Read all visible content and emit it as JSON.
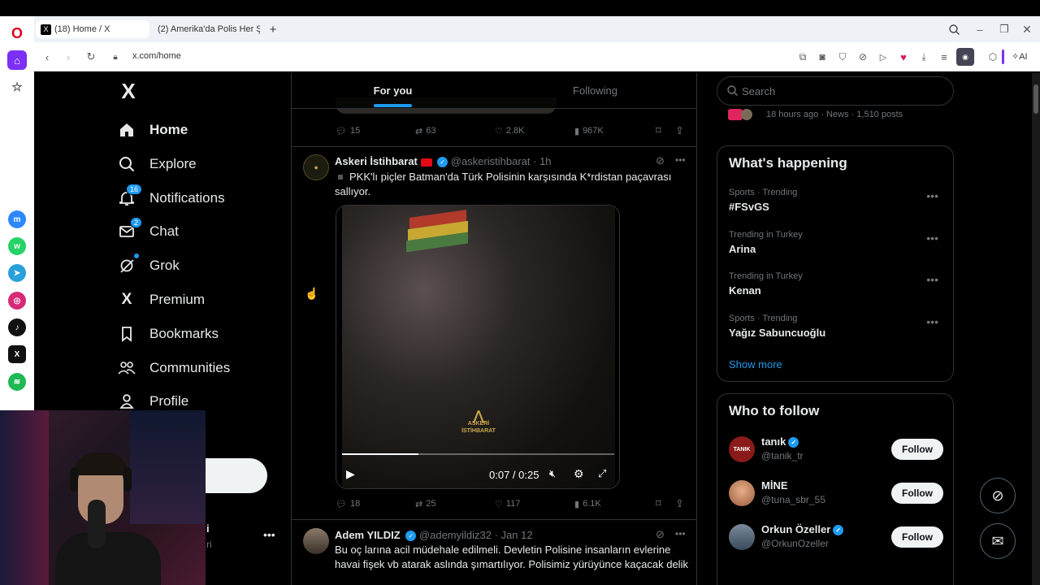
{
  "browser": {
    "tabs": [
      {
        "title": "(18) Home / X",
        "active": true
      },
      {
        "title": "(2) Amerika'da Polis Her Ş...",
        "active": false
      }
    ],
    "url": "x.com/home",
    "ai_label": "AI"
  },
  "sidebar": {
    "logo": "X",
    "items": [
      {
        "label": "Home",
        "icon": "home-icon",
        "badge": ""
      },
      {
        "label": "Explore",
        "icon": "search-icon",
        "badge": ""
      },
      {
        "label": "Notifications",
        "icon": "bell-icon",
        "badge": "16"
      },
      {
        "label": "Chat",
        "icon": "mail-icon",
        "badge": "2"
      },
      {
        "label": "Grok",
        "icon": "grok-icon",
        "badge": ""
      },
      {
        "label": "Premium",
        "icon": "x-icon",
        "badge": ""
      },
      {
        "label": "Bookmarks",
        "icon": "bookmark-icon",
        "badge": ""
      },
      {
        "label": "Communities",
        "icon": "people-icon",
        "badge": ""
      },
      {
        "label": "Profile",
        "icon": "person-icon",
        "badge": ""
      }
    ],
    "account_fragment_1": "i",
    "account_fragment_2": "ri"
  },
  "feed": {
    "tabs": [
      "For you",
      "Following"
    ],
    "prev_actions": {
      "replies": "15",
      "reposts": "63",
      "likes": "2.8K",
      "views": "967K"
    },
    "tweet1": {
      "name": "Askeri İstihbarat",
      "handle": "@askeristihbarat",
      "time": "1h",
      "text": "PKK'lı piçler  Batman'da Türk Polisinin karşısında K*rdistan paçavrası sallıyor.",
      "video_time": "0:07 / 0:25",
      "watermark_line1": "ASKERİ",
      "watermark_line2": "İSTİHBARAT",
      "progress": 0.28,
      "actions": {
        "replies": "18",
        "reposts": "25",
        "likes": "117",
        "views": "6.1K"
      }
    },
    "tweet2": {
      "name": "Adem YILDIZ",
      "handle": "@ademyildiz32",
      "time": "Jan 12",
      "text": "Bu oç larına acil müdehale edilmeli. Devletin Polisine insanların evlerine havai fişek vb atarak aslında şımartılıyor. Polisimiz yürüyünce kaçacak delik"
    }
  },
  "right": {
    "search_placeholder": "Search",
    "news_meta": "18 hours ago · News · 1,510 posts",
    "whats_happening": "What's happening",
    "trends": [
      {
        "category": "Sports · Trending",
        "title": "#FSvGS"
      },
      {
        "category": "Trending in Turkey",
        "title": "Arina"
      },
      {
        "category": "Trending in Turkey",
        "title": "Kenan"
      },
      {
        "category": "Sports · Trending",
        "title": "Yağız Sabuncuoğlu"
      }
    ],
    "show_more": "Show more",
    "who_to_follow": "Who to follow",
    "follow_label": "Follow",
    "suggestions": [
      {
        "name": "tanık",
        "handle": "@tanik_tr",
        "verified": true,
        "avatar_text": "TANIK",
        "color": "#8b1a1a"
      },
      {
        "name": "MİNE",
        "handle": "@tuna_sbr_55",
        "verified": false,
        "avatar_text": "",
        "color": "#c98a5a"
      },
      {
        "name": "Orkun Özeller",
        "handle": "@OrkunOzeller",
        "verified": true,
        "avatar_text": "",
        "color": "#4a5a6a"
      }
    ]
  }
}
